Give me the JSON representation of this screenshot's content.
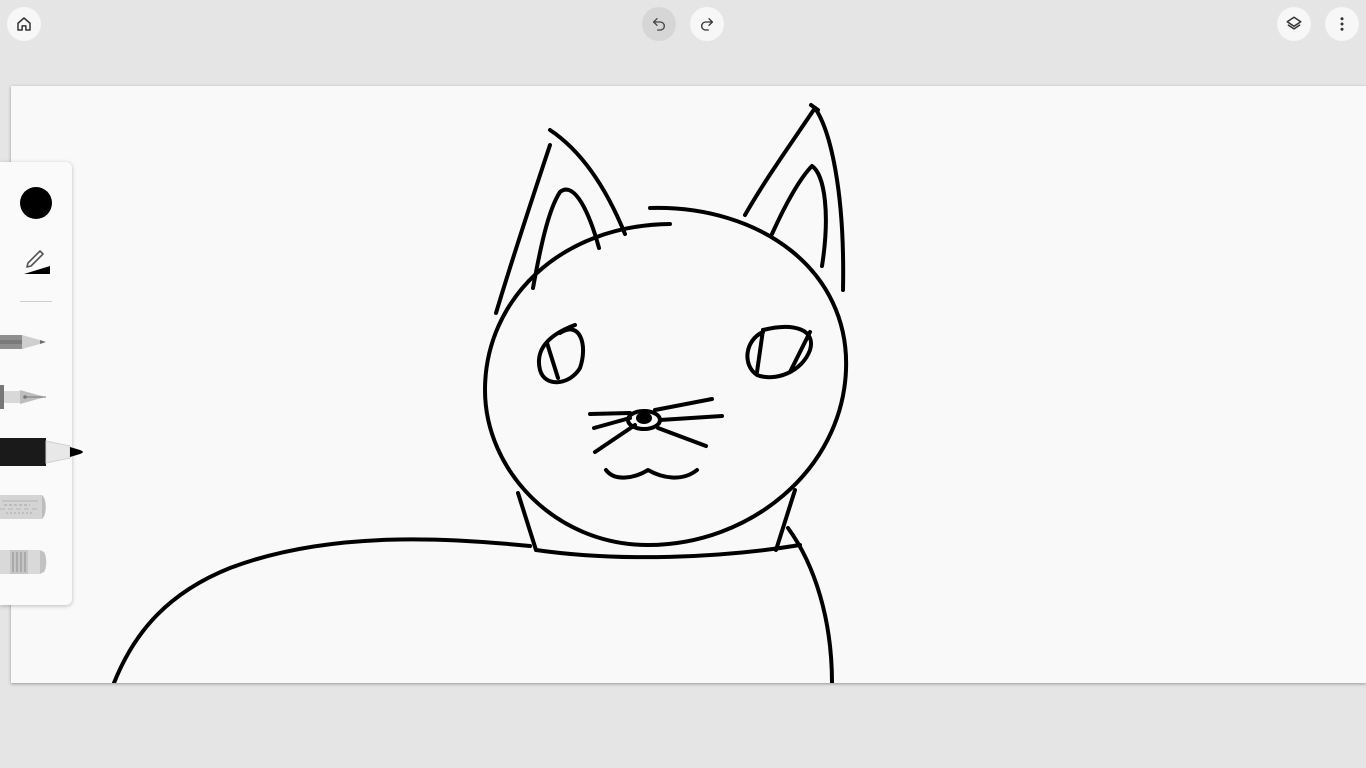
{
  "header": {
    "home_icon": "home-icon",
    "undo_icon": "undo-icon",
    "redo_icon": "redo-icon",
    "layers_icon": "layers-icon",
    "menu_icon": "more-vertical-icon"
  },
  "toolbox": {
    "selected_color": "#000000",
    "tools": [
      {
        "name": "pencil",
        "icon": "pencil-icon",
        "selected": false
      },
      {
        "name": "fountain-pen",
        "icon": "fountain-pen-icon",
        "selected": false
      },
      {
        "name": "marker",
        "icon": "marker-icon",
        "selected": true
      },
      {
        "name": "texture-brush",
        "icon": "texture-brush-icon",
        "selected": false
      },
      {
        "name": "eraser",
        "icon": "eraser-icon",
        "selected": false
      }
    ]
  },
  "canvas": {
    "background": "#f9f9f9",
    "stroke_color": "#000000",
    "drawing": "cat-sketch"
  },
  "colors": {
    "app_background": "#e5e5e5",
    "button_background": "#f7f7f7",
    "button_pressed": "#d6d6d6"
  }
}
